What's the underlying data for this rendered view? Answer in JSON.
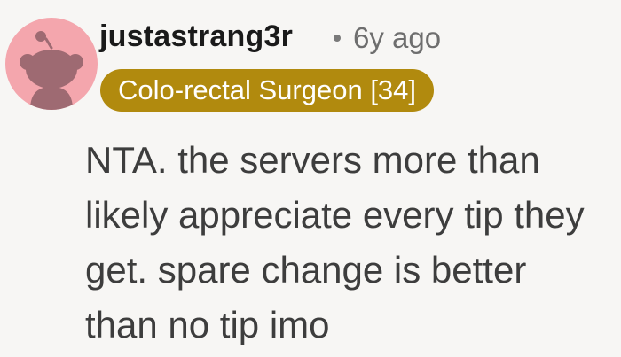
{
  "comment": {
    "avatar_icon": "reddit-snoo-icon",
    "username": "justastrang3r",
    "separator": "•",
    "age": "6y ago",
    "flair": "Colo-rectal Surgeon [34]",
    "flair_color": "#b18a0e",
    "avatar_color": "#f4a6ad",
    "body_lines": [
      "NTA. the servers more than",
      "likely appreciate every tip they",
      "get. spare change is better",
      "than no tip imo"
    ]
  }
}
